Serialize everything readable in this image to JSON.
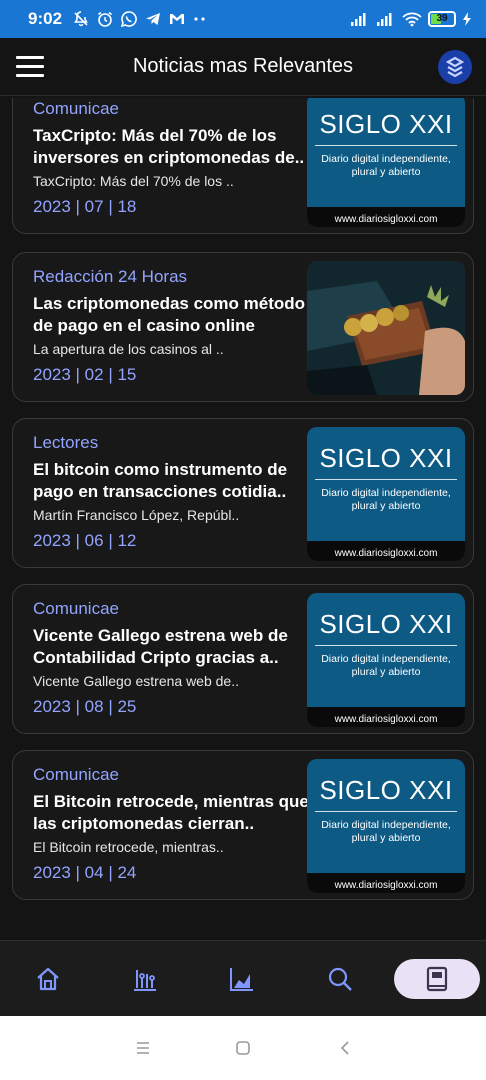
{
  "status": {
    "time": "9:02",
    "battery": "39",
    "icons": [
      "mute-icon",
      "alarm-icon",
      "whatsapp-icon",
      "telegram-icon",
      "gmail-icon",
      "more-dots-icon",
      "signal-icon",
      "signal-icon",
      "wifi-icon",
      "battery-icon",
      "charging-icon"
    ]
  },
  "appbar": {
    "title": "Noticias mas Relevantes"
  },
  "siglo_thumb": {
    "brand": "SIGLO XXI",
    "tagline_1": "Diario digital independiente,",
    "tagline_2": "plural y abierto",
    "footer": "www.diariosigloxxi.com"
  },
  "articles": [
    {
      "source": "Comunicae",
      "headline_1": "TaxCripto: Más del 70% de los",
      "headline_2": "inversores en criptomonedas de..",
      "snippet": "TaxCripto: Más del 70% de los ..",
      "date": "2023 | 07 | 18",
      "thumb": "siglo"
    },
    {
      "source": "Redacción 24 Horas",
      "headline_1": "Las criptomonedas como método",
      "headline_2": "de pago en el casino online",
      "snippet": "La apertura de los casinos al ..",
      "date": "2023 | 02 | 15",
      "thumb": "photo"
    },
    {
      "source": "Lectores",
      "headline_1": "El bitcoin como instrumento de",
      "headline_2": "pago en transacciones cotidia..",
      "snippet": "Martín Francisco López, Repúbl..",
      "date": "2023 | 06 | 12",
      "thumb": "siglo"
    },
    {
      "source": "Comunicae",
      "headline_1": "Vicente Gallego estrena web de",
      "headline_2": "Contabilidad Cripto gracias a..",
      "snippet": "Vicente Gallego estrena web de..",
      "date": "2023 | 08 | 25",
      "thumb": "siglo"
    },
    {
      "source": "Comunicae",
      "headline_1": "El Bitcoin retrocede, mientras que",
      "headline_2": "las criptomonedas cierran..",
      "snippet": "El Bitcoin retrocede, mientras..",
      "date": "2023 | 04 | 24",
      "thumb": "siglo"
    }
  ],
  "bottom_nav": [
    "home-icon",
    "equalizer-icon",
    "chart-icon",
    "search-icon",
    "book-icon"
  ],
  "colors": {
    "statusbar": "#1976d2",
    "accent": "#93a4ff",
    "siglo_blue": "#0d5a84",
    "nav_active": "#e9e1f5"
  }
}
